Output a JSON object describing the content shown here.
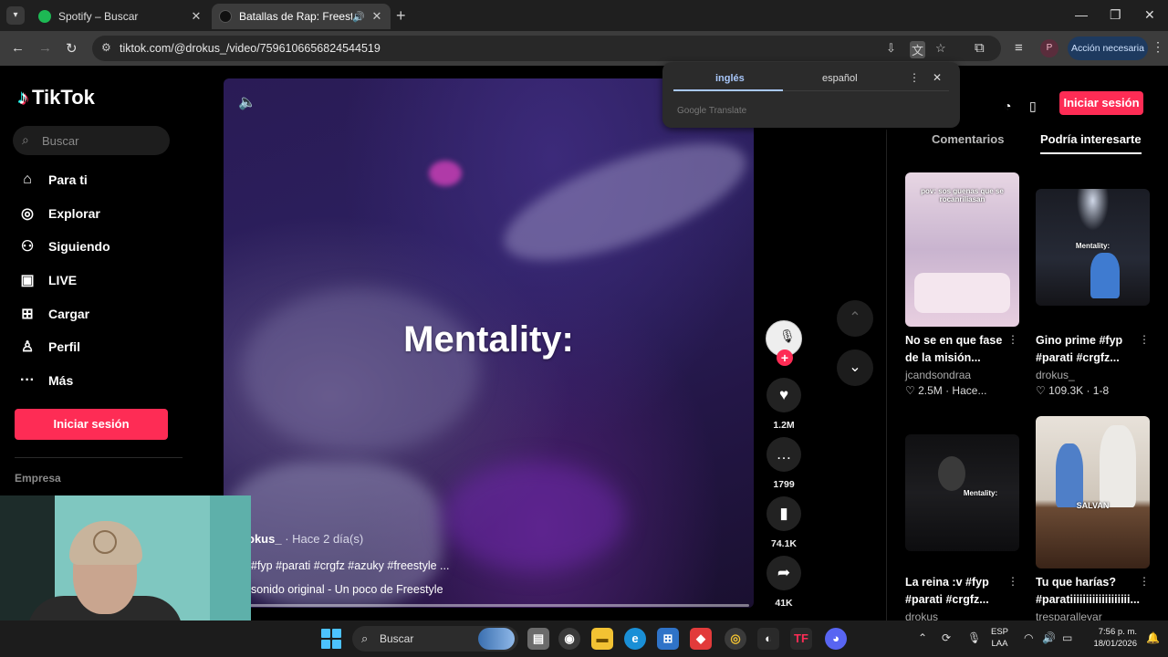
{
  "browser": {
    "tabs": [
      {
        "title": "Spotify – Buscar",
        "favicon_color": "#1db954"
      },
      {
        "title": "Batallas de Rap: Freestyle c",
        "favicon_color": "#111111"
      }
    ],
    "url": "tiktok.com/@drokus_/video/7596106656824544519",
    "action_label": "Acción necesaria",
    "profile_initial": "P"
  },
  "tiktok": {
    "brand": "TikTok",
    "search_placeholder": "Buscar",
    "nav": [
      {
        "label": "Para ti",
        "icon": "home-icon"
      },
      {
        "label": "Explorar",
        "icon": "compass-icon"
      },
      {
        "label": "Siguiendo",
        "icon": "following-icon"
      },
      {
        "label": "LIVE",
        "icon": "live-icon"
      },
      {
        "label": "Cargar",
        "icon": "upload-icon"
      },
      {
        "label": "Perfil",
        "icon": "profile-icon"
      },
      {
        "label": "Más",
        "icon": "more-icon"
      }
    ],
    "sidebar_login": "Iniciar sesión",
    "footer_section": "Empresa",
    "header_login": "Iniciar sesión",
    "accent": "#fe2c55"
  },
  "video": {
    "overlay_text": "Mentality:",
    "author": "okus_",
    "time_ago": "· Hace 2 día(s)",
    "description": "#fyp #parati #crgfz #azuky #freestyle ...",
    "sound": "sonido original - Un poco de Freestyle",
    "likes": "1.2M",
    "comments": "1799",
    "saves": "74.1K",
    "shares": "41K"
  },
  "right_panel": {
    "tabs": [
      "Comentarios",
      "Podría interesarte"
    ],
    "cards": [
      {
        "title": "No se en que fase de la misión...",
        "author": "jcandsondraa",
        "stats": "♡ 2.5M · Hace...",
        "caption": "pov: sos guenas que se rocanriliasan"
      },
      {
        "title": "Gino prime #fyp #parati #crgfz...",
        "author": "drokus_",
        "stats": "♡ 109.3K · 1-8",
        "caption": "Mentality:"
      },
      {
        "title": "La reina :v #fyp #parati #crgfz...",
        "author": "drokus_",
        "stats": "",
        "caption": "Mentality:"
      },
      {
        "title": "Tu que harías? #paratiiiiiiiiiiiiiiiiiii...",
        "author": "tresparallevar",
        "stats": "",
        "caption": "SALVAN"
      }
    ]
  },
  "translate": {
    "lang_from": "inglés",
    "lang_to": "español",
    "brand": "Google Translate"
  },
  "taskbar": {
    "search": "Buscar",
    "lang_line1": "ESP",
    "lang_line2": "LAA",
    "time": "7:56 p. m.",
    "date": "18/01/2026"
  }
}
